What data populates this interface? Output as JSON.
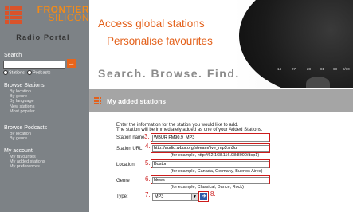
{
  "brand": {
    "logo_line1": "FRONTIER",
    "logo_line2": "SILICON",
    "logo_sub": "Radio Portal"
  },
  "sidebar": {
    "search_label": "Search",
    "search_go": "→",
    "search_opt_stations": "Stations",
    "search_opt_podcasts": "Podcasts",
    "browse_stations_head": "Browse Stations",
    "browse_stations_items": [
      "By location",
      "By genre",
      "By language",
      "New stations",
      "Most popular"
    ],
    "browse_podcasts_head": "Browse Podcasts",
    "browse_podcasts_items": [
      "By location",
      "By genre"
    ],
    "account_head": "My account",
    "account_items": [
      "My favourites",
      "My added stations",
      "My preferences"
    ]
  },
  "banner": {
    "tagline1": "Access global stations",
    "tagline2": "Personalise favourites",
    "tagline3": "Search. Browse. Find.",
    "presets": [
      "14",
      "27",
      "28",
      "81",
      "68",
      "8/10"
    ]
  },
  "section": {
    "title": "My added stations"
  },
  "form": {
    "intro1": "Enter the information for the station you would like to add.",
    "intro2": "The station will be immediately added as one of your Added Stations.",
    "station_name_label": "Station name",
    "station_name_value": "WBUR FM90.9_MP3",
    "station_url_label": "Station URL",
    "station_url_value": "http://audio.wbur.org/stream/live_mp3.m3u",
    "station_url_example": "(for example, http://62.168.116.98:8000/dsp1)",
    "location_label": "Location",
    "location_value": "Boston",
    "location_example": "(for example, Canada, Germany, Buenos Aires)",
    "genre_label": "Genre",
    "genre_value": "News",
    "genre_example": "(for example, Classical, Dance, Rock)",
    "type_label": "Type:",
    "type_value": "MP3",
    "steps": [
      "3.",
      "4.",
      "5.",
      "6.",
      "7.",
      "8."
    ]
  },
  "colors": {
    "accent": "#e3601a",
    "sidebar_bg": "#7d8286",
    "section_bar": "#a5a5a5",
    "highlight": "#cc1b1b"
  }
}
